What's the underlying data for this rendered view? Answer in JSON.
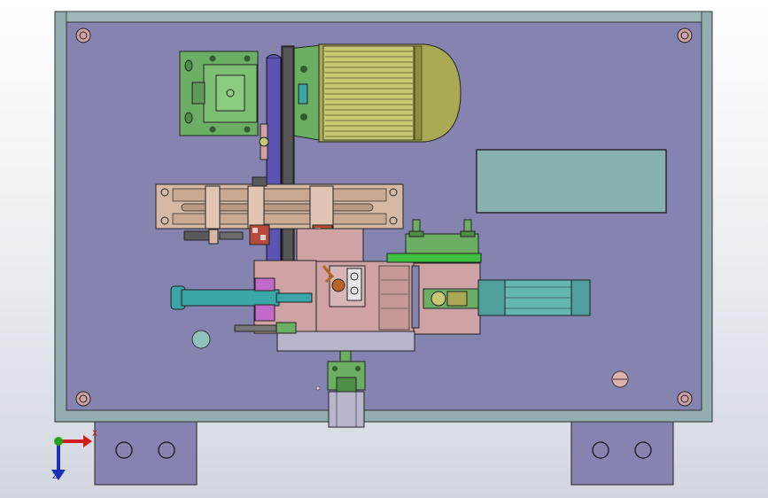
{
  "viewport": {
    "background_top": "#ffffff",
    "background_bottom": "#d2d7df"
  },
  "colors": {
    "frame_outer": "#93aeb0",
    "plate": "#8584b0",
    "motor_body": "#a9a853",
    "motor_fins": "#d8d786",
    "green_part": "#6cae64",
    "pink_part": "#cfa3a3",
    "tan_part": "#d6b9a4",
    "cyan_rod": "#3ba6a8",
    "teal_cylinder": "#64b6b3",
    "belt": "#5a55b2",
    "label_plate": "#88b1ae",
    "bright_green": "#3fbf3f",
    "magenta": "#c36ac8",
    "orange": "#b86423",
    "red_block": "#b84a3c",
    "axis_x": "#d21b1b",
    "axis_y": "#21a321",
    "axis_z": "#1c2fb8"
  },
  "triad": {
    "x_label": "X",
    "z_label": "Z"
  },
  "icons": {
    "orientation_triad": "xyz-axis-triad"
  }
}
